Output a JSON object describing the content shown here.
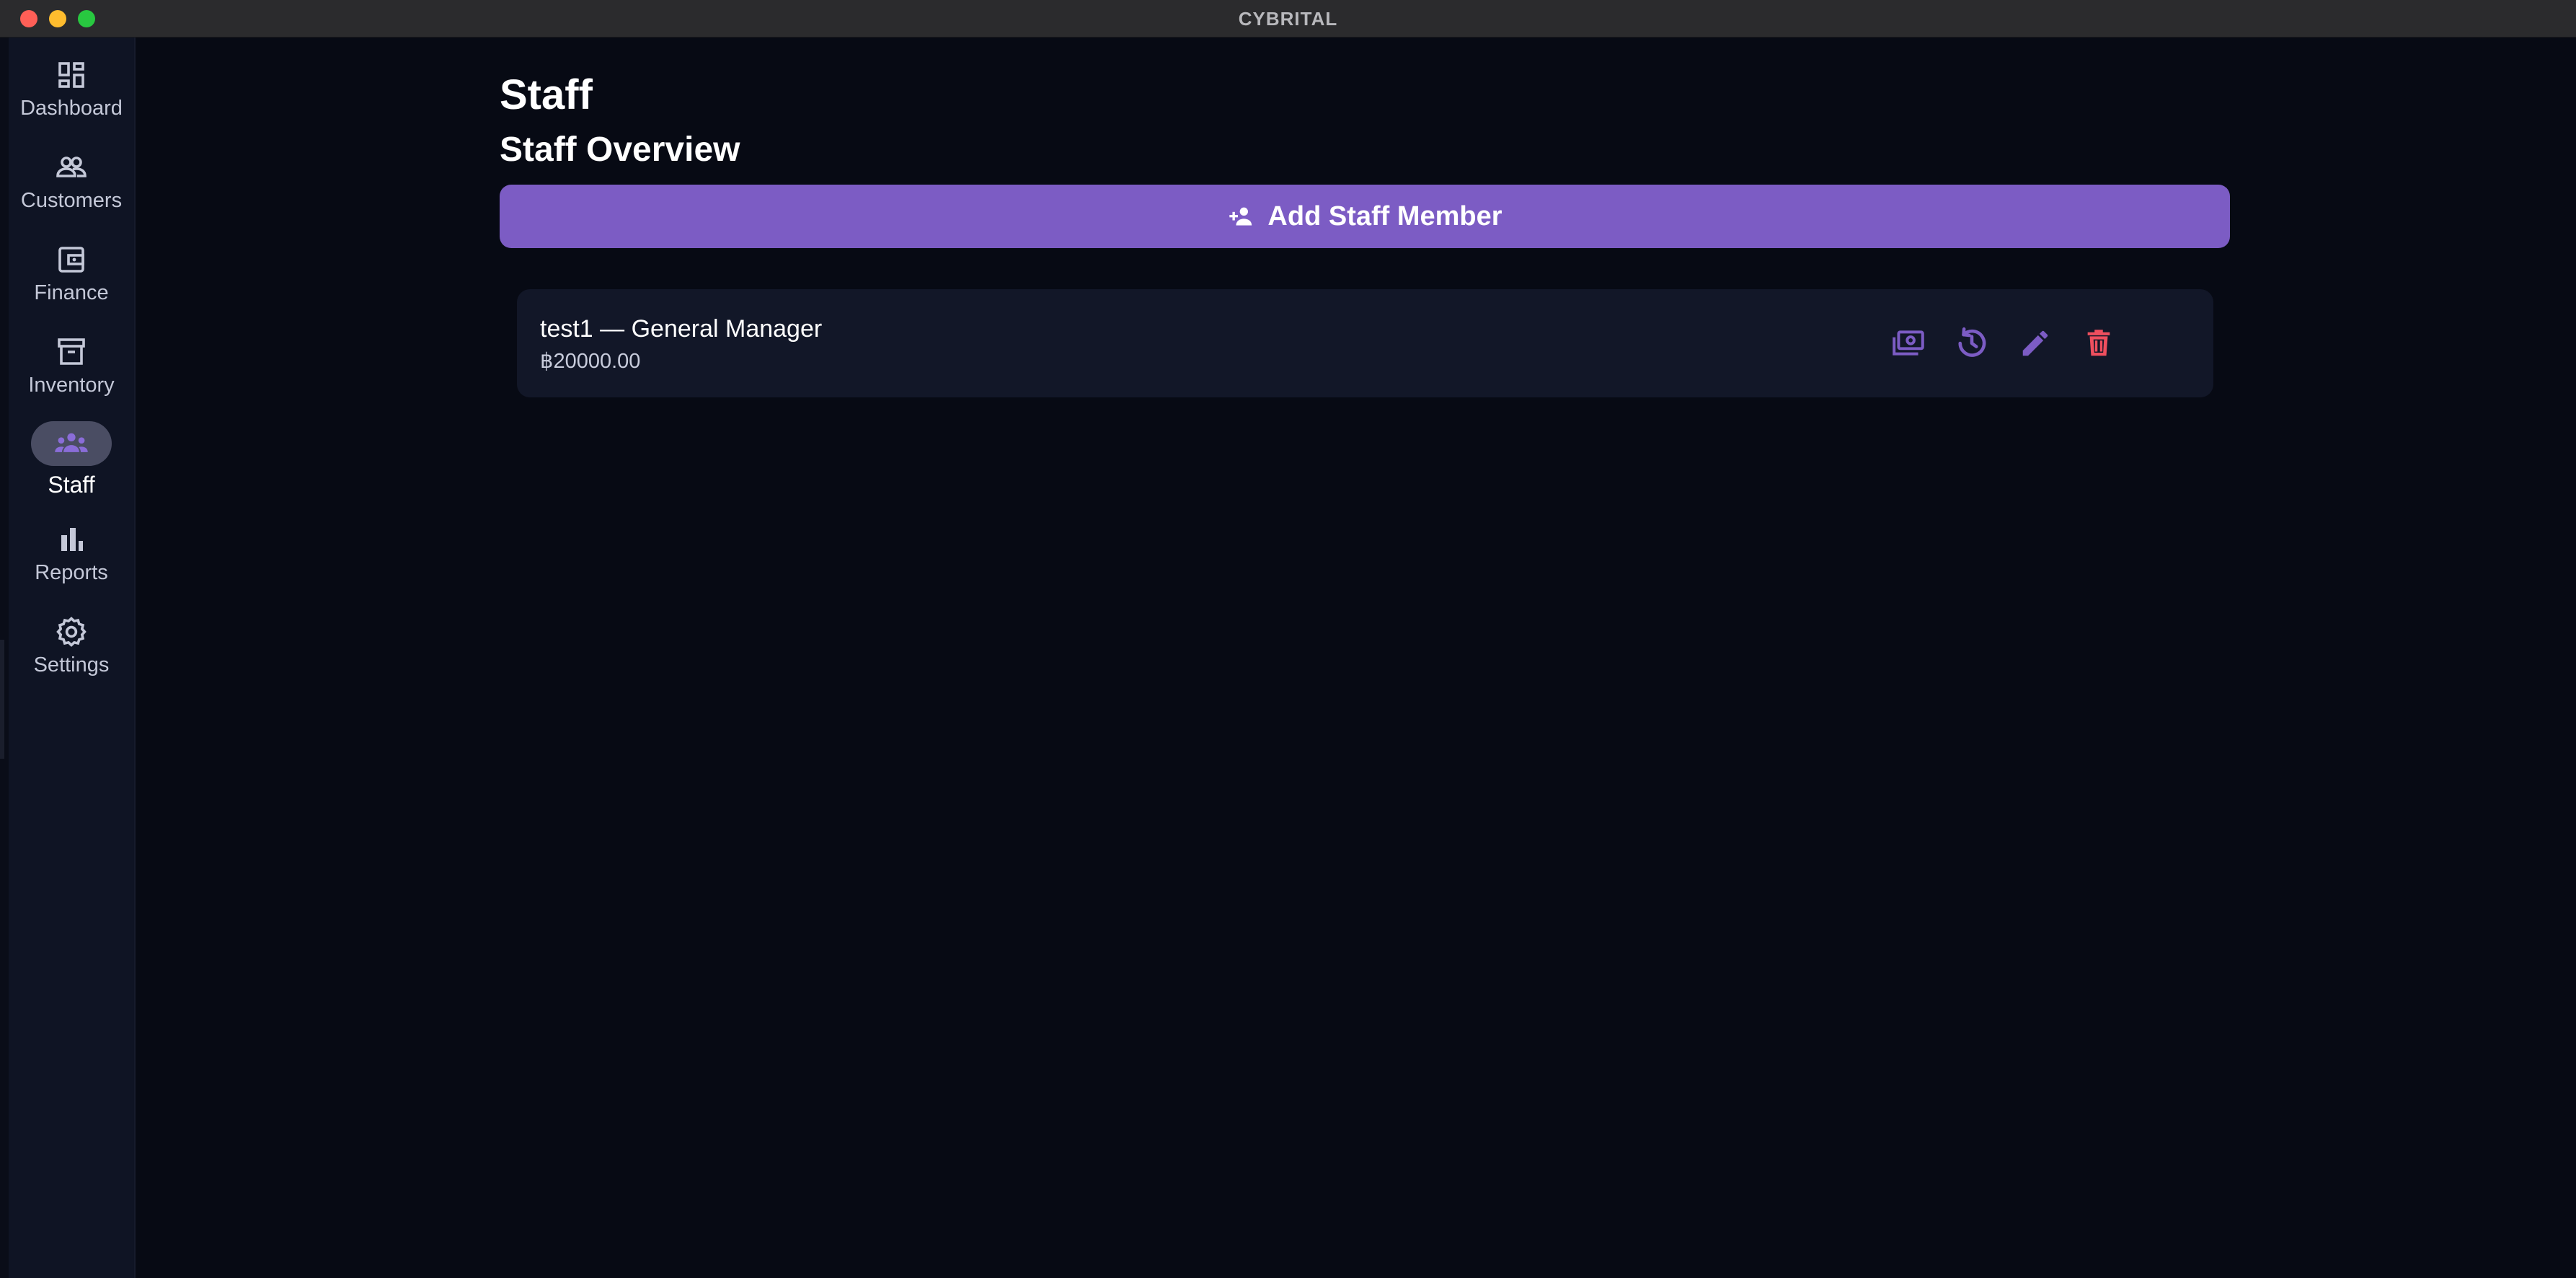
{
  "window": {
    "title": "CYBRITAL"
  },
  "sidebar": {
    "items": [
      {
        "label": "Dashboard",
        "icon": "dashboard-icon",
        "active": false
      },
      {
        "label": "Customers",
        "icon": "people-icon",
        "active": false
      },
      {
        "label": "Finance",
        "icon": "wallet-icon",
        "active": false
      },
      {
        "label": "Inventory",
        "icon": "archive-box-icon",
        "active": false
      },
      {
        "label": "Staff",
        "icon": "groups-icon",
        "active": true
      },
      {
        "label": "Reports",
        "icon": "bar-chart-icon",
        "active": false
      },
      {
        "label": "Settings",
        "icon": "gear-icon",
        "active": false
      }
    ]
  },
  "main": {
    "page_title": "Staff",
    "section_title": "Staff Overview",
    "add_button_label": "Add Staff Member",
    "staff": [
      {
        "name_role": "test1 — General Manager",
        "salary": "฿20000.00",
        "actions": [
          "payments-icon",
          "history-icon",
          "edit-icon",
          "delete-icon"
        ]
      }
    ]
  },
  "colors": {
    "accent": "#7c5cc4",
    "background": "#070a14",
    "sidebar": "#0f1424",
    "card": "#121728",
    "danger": "#ef4f5e",
    "active_pill": "#4a4d63"
  }
}
